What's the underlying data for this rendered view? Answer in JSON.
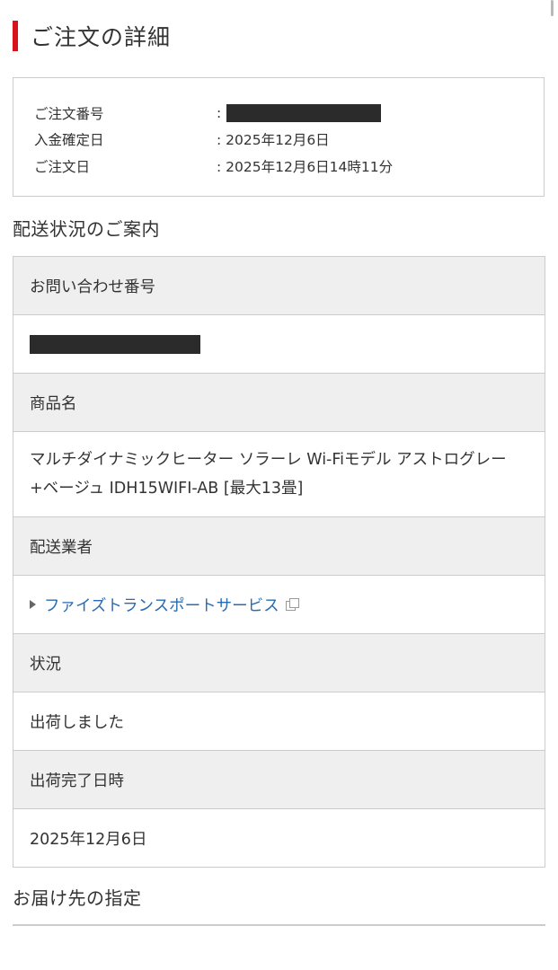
{
  "page": {
    "title": "ご注文の詳細",
    "accent_color": "#d7141c"
  },
  "order": {
    "rows": [
      {
        "label": "ご注文番号",
        "value": "",
        "redacted": true
      },
      {
        "label": "入金確定日",
        "value": ": 2025年12月6日",
        "redacted": false
      },
      {
        "label": "ご注文日",
        "value": ": 2025年12月6日14時11分",
        "redacted": false
      }
    ],
    "order_number_colon": ":"
  },
  "shipping": {
    "heading": "配送状況のご案内",
    "tracking_label": "お問い合わせ番号",
    "tracking_value_redacted": true,
    "product_label": "商品名",
    "product_value": "マルチダイナミックヒーター ソラーレ Wi-Fiモデル アストログレー+ベージュ IDH15WIFI-AB [最大13畳]",
    "carrier_label": "配送業者",
    "carrier_link": "ファイズトランスポートサービス",
    "carrier_link_icon": "external-window-icon",
    "status_label": "状況",
    "status_value": "出荷しました",
    "shipped_label": "出荷完了日時",
    "shipped_value": "2025年12月6日",
    "link_color": "#2a6bb0",
    "header_bg": "#efefef"
  },
  "delivery": {
    "heading": "お届け先の指定"
  }
}
